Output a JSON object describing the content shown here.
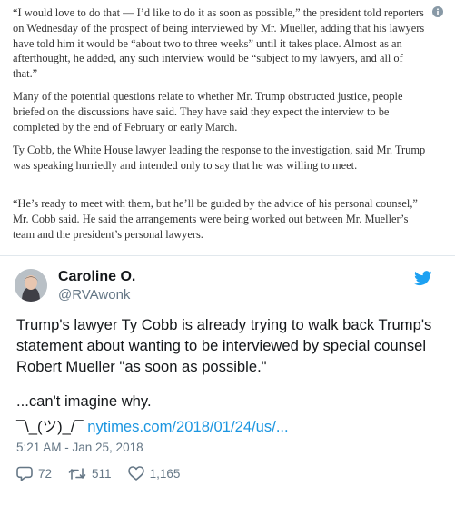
{
  "article": {
    "paragraphs": [
      "“I would love to do that — I’d like to do it as soon as possible,” the president told reporters on Wednesday of the prospect of being interviewed by Mr. Mueller, adding that his lawyers have told him it would be “about two to three weeks” until it takes place. Almost as an afterthought, he added, any such interview would be “subject to my lawyers, and all of that.”",
      "Many of the potential questions relate to whether Mr. Trump obstructed justice, people briefed on the discussions have said. They have said they expect the interview to be completed by the end of February or early March.",
      "Ty Cobb, the White House lawyer leading the response to the investigation, said Mr. Trump was speaking hurriedly and intended only to say that he was willing to meet.",
      "“He’s ready to meet with them, but he’ll be guided by the advice of his personal counsel,” Mr. Cobb said. He said the arrangements were being worked out between Mr. Mueller’s team and the president’s personal lawyers."
    ]
  },
  "tweet": {
    "display_name": "Caroline O.",
    "handle": "@RVAwonk",
    "text": "Trump's lawyer Ty Cobb is already trying to walk back Trump's statement about wanting to be interviewed by special counsel Robert Mueller \"as soon as possible.\"",
    "line2": "...can't imagine why.",
    "shrug": "¯\\_(ツ)_/¯",
    "link": "nytimes.com/2018/01/24/us/...",
    "timestamp": "5:21 AM - Jan 25, 2018",
    "replies": "72",
    "retweets": "511",
    "likes": "1,165"
  },
  "colors": {
    "link": "#1b95e0",
    "twitter_blue": "#1da1f2",
    "muted": "#657786"
  },
  "icons": [
    "info-icon",
    "twitter-bird-icon",
    "reply-icon",
    "retweet-icon",
    "like-icon"
  ]
}
